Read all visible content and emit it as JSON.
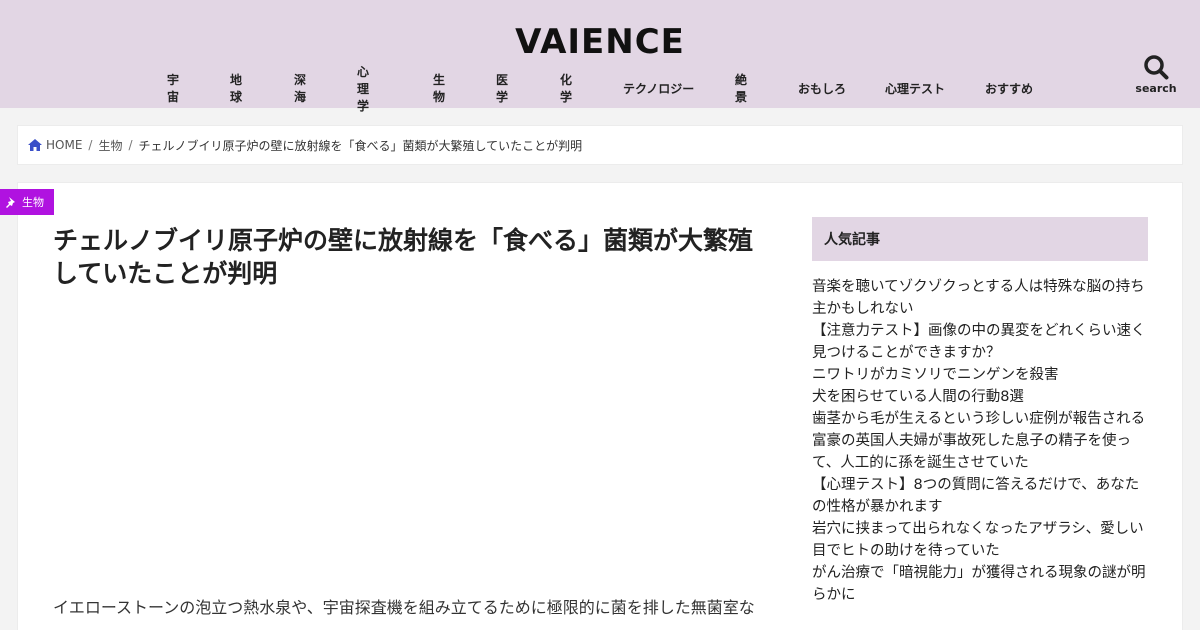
{
  "header": {
    "logo": "VAIENCE",
    "nav": [
      "宇宙",
      "地球",
      "深海",
      "心理学",
      "生物",
      "医学",
      "化学",
      "テクノロジー",
      "絶景",
      "おもしろ",
      "心理テスト",
      "おすすめ"
    ],
    "search_label": "search"
  },
  "breadcrumb": {
    "home": "HOME",
    "category": "生物",
    "current": "チェルノブイリ原子炉の壁に放射線を「食べる」菌類が大繁殖していたことが判明"
  },
  "article": {
    "category_label": "生物",
    "title": "チェルノブイリ原子炉の壁に放射線を「食べる」菌類が大繁殖していたことが判明",
    "body_first_line": "イエローストーンの泡立つ熱水泉や、宇宙探査機を組み立てるために極限的に菌を排した無菌室な"
  },
  "sidebar": {
    "widget_title": "人気記事",
    "popular": [
      "音楽を聴いてゾクゾクっとする人は特殊な脳の持ち主かもしれない",
      "【注意力テスト】画像の中の異変をどれくらい速く見つけることができますか？",
      "ニワトリがカミソリでニンゲンを殺害",
      "犬を困らせている人間の行動8選",
      "歯茎から毛が生えるという珍しい症例が報告される",
      "富豪の英国人夫婦が事故死した息子の精子を使って、人工的に孫を誕生させていた",
      "【心理テスト】8つの質問に答えるだけで、あなたの性格が暴かれます",
      "岩穴に挟まって出られなくなったアザラシ、愛しい目でヒトの助けを待っていた",
      "がん治療で「暗視能力」が獲得される現象の謎が明らかに"
    ]
  },
  "colors": {
    "header_bg": "#e2d6e4",
    "category_badge": "#b012e0",
    "home_icon": "#3a4fc8"
  },
  "icons": {
    "search": "search-icon",
    "home": "home-icon",
    "pin": "pin-icon"
  }
}
